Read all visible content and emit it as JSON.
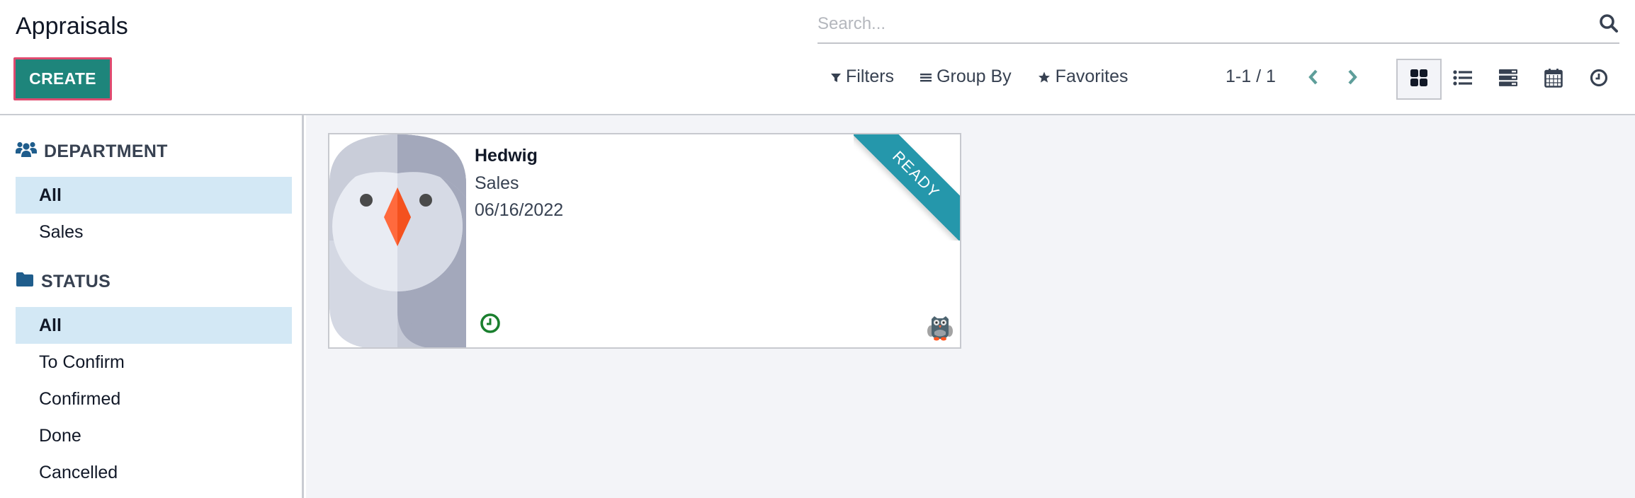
{
  "header": {
    "title": "Appraisals",
    "create_label": "CREATE"
  },
  "search": {
    "placeholder": "Search...",
    "value": ""
  },
  "search_options": {
    "filters_label": "Filters",
    "group_by_label": "Group By",
    "favorites_label": "Favorites"
  },
  "pager": {
    "value": "1-1 / 1"
  },
  "views": [
    {
      "name": "kanban",
      "icon": "kanban-grid-icon",
      "active": true
    },
    {
      "name": "list",
      "icon": "list-icon",
      "active": false
    },
    {
      "name": "activity-list",
      "icon": "server-stack-icon",
      "active": false
    },
    {
      "name": "calendar",
      "icon": "calendar-icon",
      "active": false
    },
    {
      "name": "activity",
      "icon": "clock-icon",
      "active": false
    }
  ],
  "sidebar": {
    "department": {
      "title": "DEPARTMENT",
      "icon": "users-icon",
      "items": [
        {
          "label": "All",
          "active": true
        },
        {
          "label": "Sales",
          "active": false
        }
      ]
    },
    "status": {
      "title": "STATUS",
      "icon": "folder-icon",
      "items": [
        {
          "label": "All",
          "active": true
        },
        {
          "label": "To Confirm",
          "active": false
        },
        {
          "label": "Confirmed",
          "active": false
        },
        {
          "label": "Done",
          "active": false
        },
        {
          "label": "Cancelled",
          "active": false
        }
      ]
    }
  },
  "cards": [
    {
      "name": "Hedwig",
      "department": "Sales",
      "date": "06/16/2022",
      "ribbon": "READY",
      "ribbon_color": "#2597ab",
      "activity_color": "#1a7f2e",
      "image": "owl-avatar",
      "owner_avatar": "owl-small-avatar"
    }
  ],
  "colors": {
    "primary": "#1e857b",
    "focus_border": "#df4a6f",
    "pager_arrow": "#5e9e9a",
    "sidebar_active": "#d3e8f5",
    "sidebar_icon": "#1f5d8c",
    "main_bg": "#f3f4f8"
  }
}
